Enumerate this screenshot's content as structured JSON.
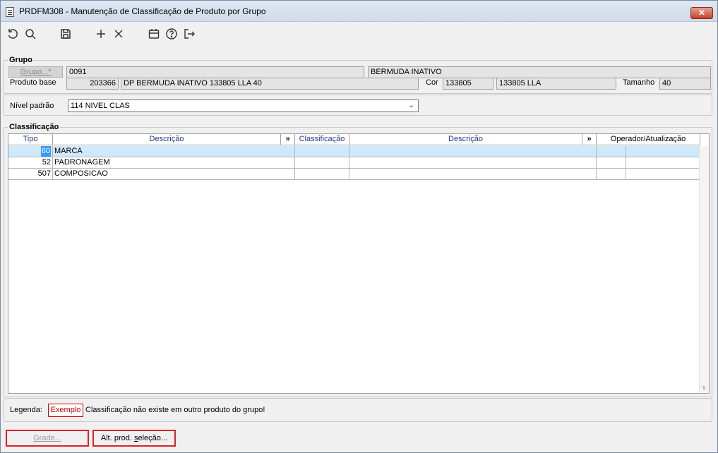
{
  "window": {
    "title": "PRDFM308 - Manutenção de Classificação de Produto por Grupo",
    "close_label": "✕"
  },
  "toolbar": {
    "icons": [
      "undo-icon",
      "search-icon",
      "save-icon",
      "add-icon",
      "delete-icon",
      "calendar-icon",
      "help-icon",
      "exit-icon"
    ]
  },
  "grupo": {
    "section_title": "Grupo",
    "grupo_button": "Grupo...*",
    "grupo_code": "0091",
    "grupo_desc": "BERMUDA INATIVO",
    "produto_base_label": "Produto base",
    "produto_base_code": "203366",
    "produto_base_desc": "DP BERMUDA INATIVO 133805 LLA 40",
    "cor_label": "Cor",
    "cor_code": "133805",
    "cor_desc": "133805 LLA",
    "tamanho_label": "Tamanho",
    "tamanho_value": "40"
  },
  "nivel": {
    "label": "Nível padrão",
    "selected": "114 NIVEL CLAS"
  },
  "classificacao": {
    "section_title": "Classificação",
    "columns": {
      "tipo": "Tipo",
      "descricao1": "Descrição",
      "expand1": "»",
      "classificacao": "Classificação",
      "descricao2": "Descrição",
      "expand2": "»",
      "operador": "Operador/Atualização"
    },
    "rows": [
      {
        "tipo": "60",
        "descricao": "MARCA"
      },
      {
        "tipo": "52",
        "descricao": "PADRONAGEM"
      },
      {
        "tipo": "507",
        "descricao": "COMPOSICAO"
      }
    ]
  },
  "legenda": {
    "label": "Legenda:",
    "example": "Exemplo",
    "text": "Classificação não existe em outro produto do grupo!"
  },
  "buttons": {
    "grade": "Grade...",
    "alt_prod_prefix": "Alt. prod. ",
    "alt_prod_underlined": "s",
    "alt_prod_suffix": "eleção..."
  },
  "colors": {
    "accent_red": "#e0202a",
    "selection_blue": "#3399ff",
    "header_blue": "#1f3a8c"
  }
}
